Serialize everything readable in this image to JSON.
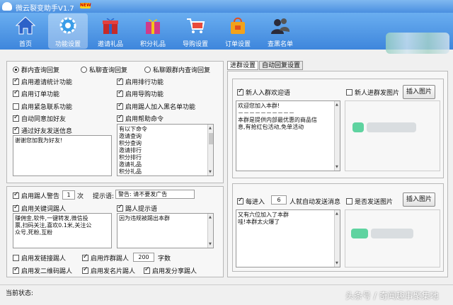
{
  "window": {
    "title": "微云裂变助手V1.7",
    "badge": "NEW"
  },
  "toolbar": [
    {
      "label": "首页",
      "icon": "home-icon"
    },
    {
      "label": "功能设置",
      "icon": "gear-icon"
    },
    {
      "label": "邀请礼品",
      "icon": "gift-icon"
    },
    {
      "label": "积分礼品",
      "icon": "gift-box-icon"
    },
    {
      "label": "导购设置",
      "icon": "cart-icon"
    },
    {
      "label": "订单设置",
      "icon": "order-bag-icon"
    },
    {
      "label": "查黑名单",
      "icon": "users-icon"
    }
  ],
  "mode": {
    "options": [
      "群内查询回复",
      "私聊查询回复",
      "私聊跟群内查询回复"
    ],
    "selected": 0
  },
  "features": {
    "left": [
      "启用邀请统计功能",
      "启用订单功能",
      "启用紧急联系功能",
      "自动同意加好友",
      "通过好友发送信息"
    ],
    "left_checked": [
      true,
      true,
      false,
      true,
      true
    ],
    "right": [
      "启用排行功能",
      "启用导购功能",
      "启用踢人加入黑名单功能",
      "启用帮助命令"
    ],
    "right_checked": [
      true,
      true,
      true,
      true
    ],
    "friend_message": "谢谢您加我为好友!",
    "help_commands": "有以下命令\n邀请查询\n积分查询\n邀请排行\n积分排行\n邀请礼品\n积分礼品\n兑换查询"
  },
  "kick": {
    "warn_label": "启用踢人警告",
    "warn_count": "1",
    "warn_unit": "次",
    "hint_label": "提示语:",
    "hint_value": "警告: 请不要发广告",
    "keyword_label": "启用关键词踢人",
    "keywords": "赚佣金,软件,一键转发,微信投\n票,扫码关注,喜欢0.1米,关注公\n众号,死粉,互粉",
    "kick_hint_label": "踢人提示语",
    "kick_hint_value": "因为违规被踢出本群",
    "link_label": "启用发链接踢人",
    "spam_label": "启用炸群踢人",
    "spam_count": "200",
    "spam_unit": "字数",
    "qrcode_label": "启用发二维码踢人",
    "card_label": "启用发名片踢人",
    "share_label": "启用发分享踢人",
    "checked": {
      "warn": true,
      "keyword": true,
      "kick_hint": true,
      "link": false,
      "spam": true,
      "qrcode": true,
      "card": true,
      "share": true
    }
  },
  "tabs": {
    "items": [
      "进群设置",
      "自动回复设置"
    ],
    "active": 0
  },
  "welcome": {
    "label": "新人入群欢迎语",
    "checked": true,
    "pic_label": "新人进群发图片",
    "pic_checked": false,
    "button": "插入图片",
    "text": "欢迎您加入本群!\n－－－－－－－－－－\n本群是提供内部最优惠的商品信\n息,有抢红包活动,免单活动"
  },
  "auto": {
    "prefix": "每进入",
    "count": "6",
    "suffix": "人就自动发送消息",
    "checked": true,
    "pic_label": "是否发送图片",
    "pic_checked": false,
    "button": "插入图片",
    "text": "又有六位加入了本群\n哇!本群太火爆了"
  },
  "status": {
    "label": "当前状态:"
  },
  "watermark": "头条号 / 奇闻趣事聚集地",
  "colors": {
    "toolbar": "#4a8fe0",
    "blur_green": "#5fd3a0"
  }
}
